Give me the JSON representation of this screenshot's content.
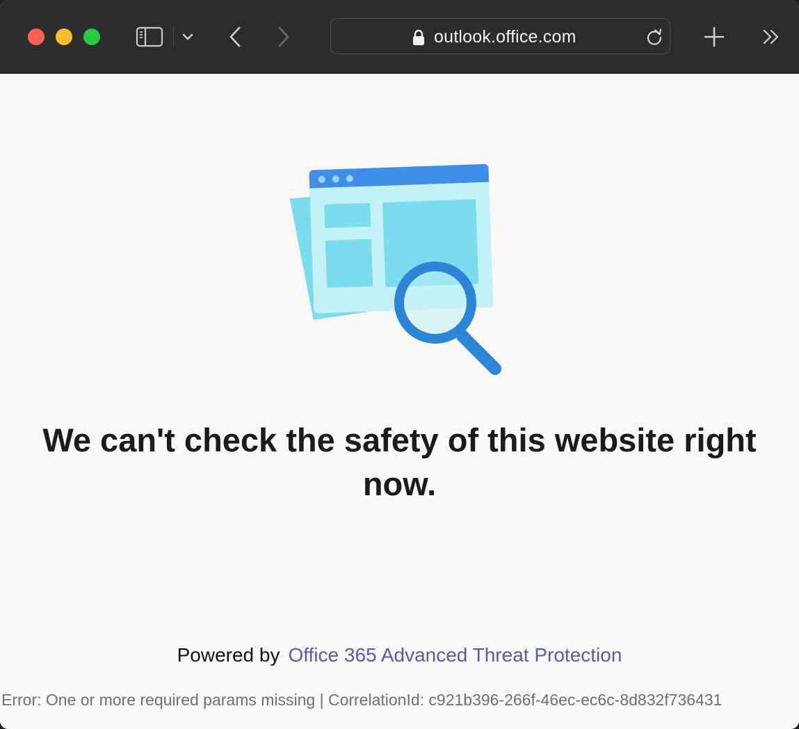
{
  "browser": {
    "url": "outlook.office.com",
    "buttons": {
      "close": "close-window",
      "minimize": "minimize-window",
      "maximize": "maximize-window"
    },
    "icons": [
      "sidebar-icon",
      "chevron-down-icon",
      "back-arrow-icon",
      "forward-arrow-icon",
      "lock-icon",
      "reload-icon",
      "plus-icon",
      "double-chevron-right-icon"
    ]
  },
  "page": {
    "headline": "We can't check the safety of this website right now.",
    "powered_by_label": "Powered by",
    "powered_by_link": "Office 365 Advanced Threat Protection",
    "error_text": "Error: One or more required params missing | CorrelationId: c921b396-266f-46ec-ec6c-8d832f736431"
  },
  "colors": {
    "toolbar_bg": "#2c2c2e",
    "page_bg": "#f9f8f7",
    "link": "#5a5aaa",
    "illustration_blue": "#3f8ee8",
    "illustration_cyan": "#79dbec"
  }
}
